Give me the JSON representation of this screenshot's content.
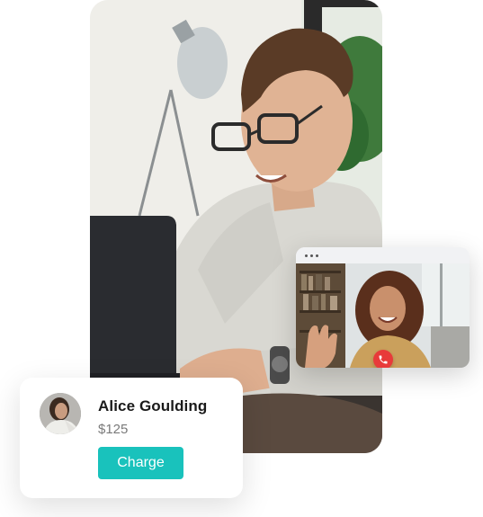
{
  "photo": {
    "icon": "man-with-laptop-photo"
  },
  "call_window": {
    "icon": "woman-waving-video",
    "hangup_icon": "phone-hangup-icon",
    "hangup_color": "#e83a3a"
  },
  "payment": {
    "name": "Alice Goulding",
    "amount": "$125",
    "button_label": "Charge",
    "button_color": "#19c2bc"
  }
}
